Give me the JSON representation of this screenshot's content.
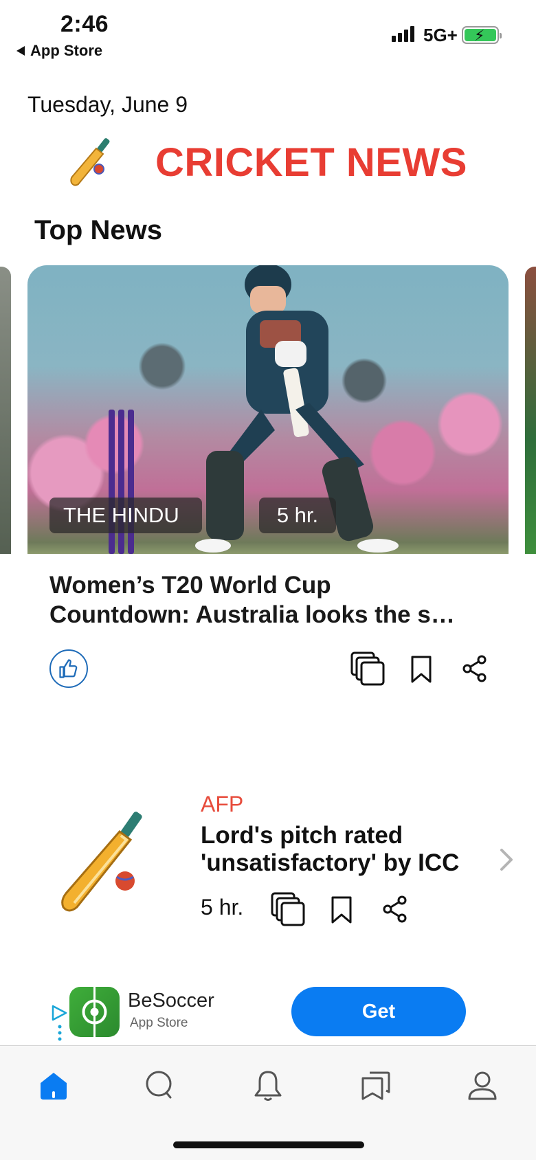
{
  "status_bar": {
    "time": "2:46",
    "back_label": "App Store",
    "network": "5G+",
    "battery_charging": true
  },
  "header": {
    "date": "Tuesday, June 9",
    "brand_title": "CRICKET NEWS",
    "brand_color": "#e83d33"
  },
  "top_news": {
    "section_title": "Top News",
    "featured": {
      "source": "THE HINDU",
      "time": "5 hr.",
      "headline_line1": "Women’s T20 World Cup",
      "headline_line2": "Countdown: Australia looks the s…",
      "image_icon": "cricket-player-photo"
    }
  },
  "article2": {
    "source": "AFP",
    "headline": "Lord's pitch rated 'unsatisfactory' by ICC",
    "time": "5 hr.",
    "thumb_icon": "cricket-bat-icon"
  },
  "ad": {
    "app_name": "BeSoccer",
    "store": "App Store",
    "cta": "Get",
    "cta_color": "#0a7cf2"
  },
  "tabbar": {
    "tabs": [
      "home",
      "search",
      "notifications",
      "saved",
      "profile"
    ],
    "active": "home",
    "accent": "#0a7cf2"
  }
}
